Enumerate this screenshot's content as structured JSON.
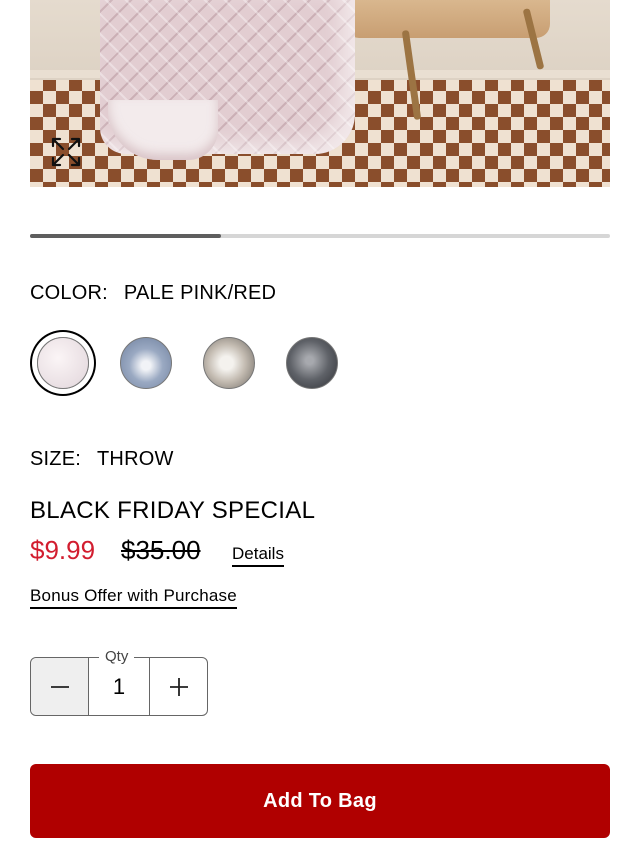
{
  "gallery": {
    "icons": {
      "zoom": "expand-arrows-icon"
    },
    "progress_fraction": 0.33
  },
  "color": {
    "key": "COLOR:",
    "value": "PALE PINK/RED",
    "swatch_names": [
      "PALE PINK/RED",
      "BLUE",
      "GREY MULTI",
      "CHARCOAL"
    ],
    "selected_index": 0
  },
  "size": {
    "key": "SIZE:",
    "value": "THROW"
  },
  "promo": {
    "title": "BLACK FRIDAY SPECIAL",
    "sale_price": "$9.99",
    "original_price": "$35.00",
    "details_label": "Details",
    "bonus_label": "Bonus Offer with Purchase"
  },
  "quantity": {
    "label": "Qty",
    "value": "1",
    "icons": {
      "decrease": "minus-icon",
      "increase": "plus-icon"
    }
  },
  "cta": {
    "add_to_bag": "Add To Bag"
  },
  "colors": {
    "sale_red": "#d21d2f",
    "cta_red": "#b00000",
    "progress_fill": "#5e5e5e",
    "progress_track": "#d6d6d6"
  }
}
